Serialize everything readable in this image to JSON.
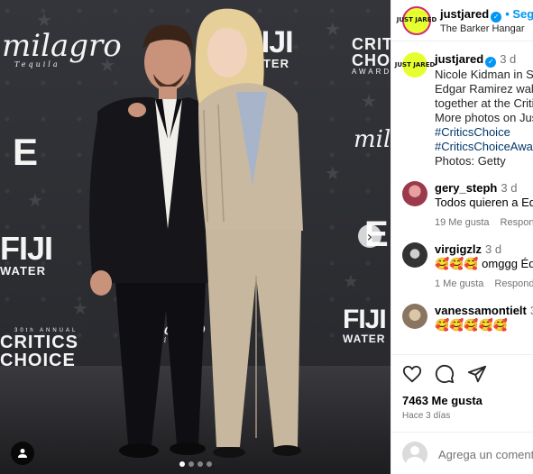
{
  "photo": {
    "logos": {
      "milagro": "milagro",
      "tequila": "Tequila",
      "fiji": "FIJI",
      "water": "WATER",
      "critics": "CRITICS",
      "choice": "CHOICE",
      "awards": "AWARDS",
      "annual": "30th ANNUAL",
      "e": "E"
    },
    "carousel_dots": 4,
    "active_dot": 0
  },
  "header": {
    "username": "justjared",
    "follow_label": "• Seguir",
    "location": "The Barker Hangar",
    "avatar_text": "JUST JARED"
  },
  "caption": {
    "username": "justjared",
    "time": "3 d",
    "lines": [
      "Nicole Kidman in Saint",
      "Edgar Ramirez walk th",
      "together at the Critics",
      "More photos on JustJa"
    ],
    "hashtags": [
      "#CriticsChoice",
      "#CriticsChoiceAwards"
    ],
    "credit": "Photos: Getty"
  },
  "comments": [
    {
      "username": "gery_steph",
      "time": "3 d",
      "text": "Todos quieren a Edg",
      "likes": "19 Me gusta",
      "reply": "Responder"
    },
    {
      "username": "virgigzlz",
      "time": "3 d",
      "text": "🥰🥰🥰 omggg Éd",
      "likes": "1 Me gusta",
      "reply": "Responder"
    },
    {
      "username": "vanessamontielt",
      "time": "3 d",
      "text": "🥰🥰🥰🥰🥰",
      "likes": "",
      "reply": ""
    }
  ],
  "actions": {
    "likes": "7463 Me gusta",
    "ago": "Hace 3 días",
    "comment_placeholder": "Agrega un comentario..."
  },
  "colors": {
    "link": "#0095f6",
    "hashtag": "#00376b",
    "muted": "#737373",
    "brand": "#e6ff2f"
  }
}
